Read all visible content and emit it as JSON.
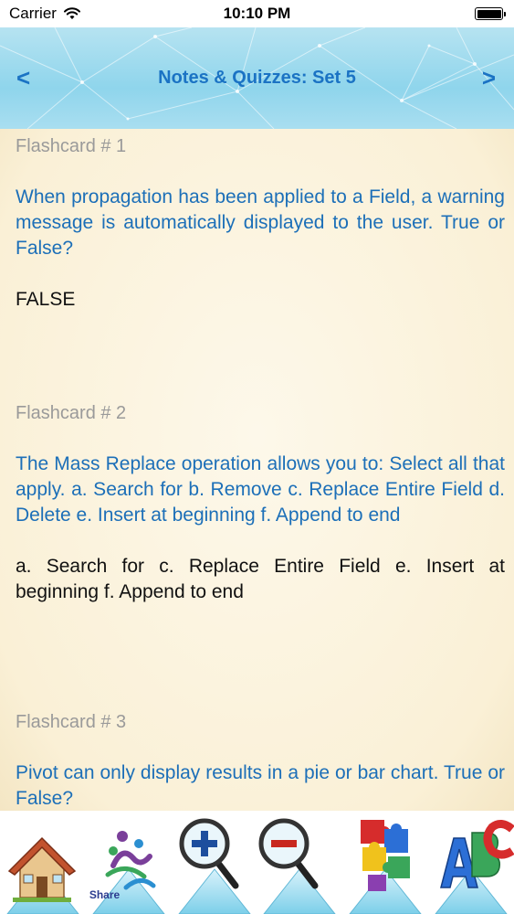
{
  "status_bar": {
    "carrier": "Carrier",
    "time": "10:10 PM"
  },
  "nav": {
    "title": "Notes & Quizzes: Set 5",
    "prev_label": "<",
    "next_label": ">"
  },
  "cards": [
    {
      "heading": "Flashcard # 1",
      "question": "When propagation has been applied to a Field, a warning message is automatically displayed to the user. True or False?",
      "answer": "FALSE"
    },
    {
      "heading": "Flashcard # 2",
      "question": "The Mass Replace operation allows you to: Select all that apply. a. Search for b. Remove c. Replace Entire Field d. Delete e. Insert at beginning f. Append to end",
      "answer": "a. Search for c. Replace Entire Field e. Insert at beginning f. Append to end"
    },
    {
      "heading": "Flashcard # 3",
      "question": "Pivot can only display results in a pie or bar chart. True or False?",
      "answer": ""
    }
  ],
  "toolbar": {
    "share_label": "Share",
    "items": [
      {
        "icon": "home-icon"
      },
      {
        "icon": "share-icon"
      },
      {
        "icon": "zoom-in-icon"
      },
      {
        "icon": "zoom-out-icon"
      },
      {
        "icon": "puzzle-icon"
      },
      {
        "icon": "abc-icon"
      }
    ]
  },
  "colors": {
    "accent": "#1b73c4",
    "question": "#1c6fb8",
    "heading": "#9a9a9a",
    "background": "#fbf3de"
  }
}
